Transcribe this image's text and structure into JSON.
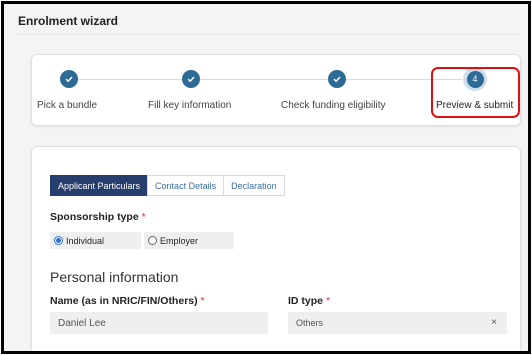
{
  "window": {
    "title": "Enrolment wizard"
  },
  "stepper": {
    "steps": [
      {
        "label": "Pick a bundle",
        "state": "completed"
      },
      {
        "label": "Fill key information",
        "state": "completed"
      },
      {
        "label": "Check funding eligibility",
        "state": "completed"
      },
      {
        "label": "Preview & submit",
        "state": "current",
        "number": "4"
      }
    ]
  },
  "tabs": [
    "Applicant Particulars",
    "Contact Details",
    "Declaration"
  ],
  "sponsorship": {
    "label": "Sponsorship type",
    "required": "*",
    "options": [
      {
        "label": "Individual",
        "selected": true
      },
      {
        "label": "Employer",
        "selected": false
      }
    ]
  },
  "personal": {
    "heading": "Personal information",
    "name_label": "Name (as in NRIC/FIN/Others)",
    "name_required": "*",
    "name_value": "Daniel Lee",
    "id_type_label": "ID type",
    "id_type_required": "*",
    "id_type_value": "Others",
    "clear_symbol": "×"
  },
  "colors": {
    "accent": "#2d6a96",
    "tab_active": "#263e6d",
    "highlight": "#e01010",
    "required": "#e03030"
  }
}
